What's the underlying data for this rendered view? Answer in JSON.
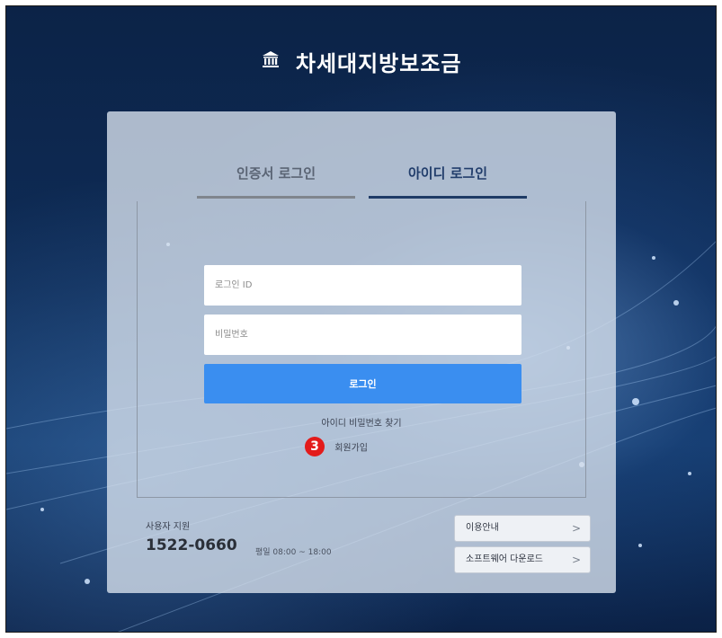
{
  "brand": {
    "title": "차세대지방보조금",
    "logo_icon": "bank-building-icon"
  },
  "tabs": [
    {
      "label": "인증서 로그인",
      "active": false
    },
    {
      "label": "아이디 로그인",
      "active": true
    }
  ],
  "form": {
    "id_placeholder": "로그인 ID",
    "password_placeholder": "비밀번호",
    "login_label": "로그인",
    "find_account_label": "아이디 비밀번호 찾기",
    "signup_label": "회원가입",
    "step_badge": "3"
  },
  "support": {
    "label": "사용자 지원",
    "phone": "1522-0660",
    "hours": "평일 08:00 ~ 18:00"
  },
  "side_buttons": {
    "guide": "이용안내",
    "download": "소프트웨어 다운로드",
    "chevron": ">"
  },
  "colors": {
    "background": "#0e2c57",
    "accent": "#3a8ef0",
    "active_tab": "#1e3b66",
    "badge": "#e31b1b"
  }
}
